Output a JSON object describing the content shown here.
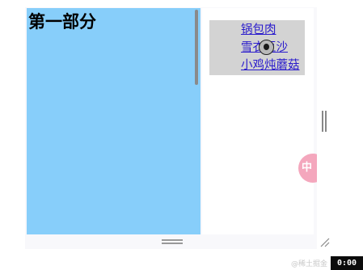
{
  "section": {
    "title": "第一部分"
  },
  "menu": {
    "items": [
      {
        "label": "锅包肉"
      },
      {
        "label": "雪衣豆沙"
      },
      {
        "label": "小鸡炖蘑菇"
      }
    ]
  },
  "badge": {
    "label": "中"
  },
  "watermark": "@稀土掘金",
  "timer": "0:00",
  "colors": {
    "left_pane": "#87cefa",
    "right_pane": "#ffffff",
    "menu_box": "#d3d3d3",
    "link": "#2a1bcc",
    "badge": "#f4a7bd"
  }
}
